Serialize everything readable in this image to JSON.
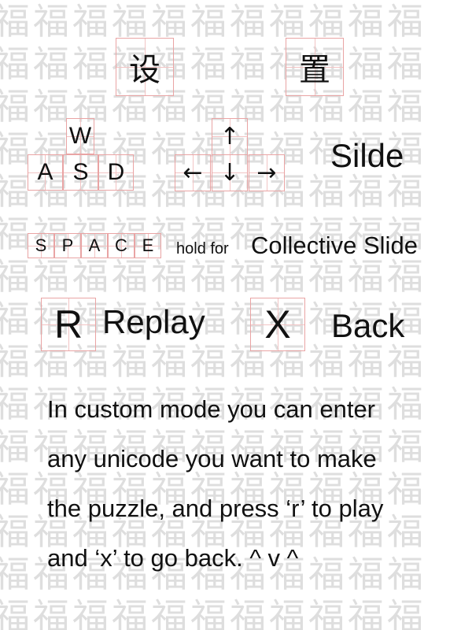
{
  "background": {
    "rows": [
      "福福福福福福福福福福福",
      "福福福福福福福福福福福",
      "福福福福福福福福福福福",
      "福福福福福福福福福福福",
      "福福福福福福福福福福福",
      "福福福福福福福福福福福",
      "福福福福福福福福福福福",
      "福福福福福福福福福福福",
      "福福福福福福福福福福福",
      "福福福福福福福福福福福",
      "福福福福福福福福福福福",
      "福福福福福福福福福福福",
      "福福福福福福福福福福福",
      "福福福福福福福福福福福",
      "福福福福福福福福福福福"
    ]
  },
  "title": {
    "char1": "设",
    "char2": "置"
  },
  "movement": {
    "keys": {
      "up": "W",
      "left": "A",
      "down": "S",
      "right": "D"
    },
    "arrows": {
      "up": "↑",
      "left": "←",
      "down": "↓",
      "right": "→"
    },
    "label": "Silde"
  },
  "space": {
    "letters": [
      "S",
      "P",
      "A",
      "C",
      "E"
    ],
    "hold_label": "hold for",
    "action_label": "Collective Slide"
  },
  "replay": {
    "key": "R",
    "label": "Replay"
  },
  "back": {
    "key": "X",
    "label": "Back"
  },
  "instructions": {
    "lines": [
      "In custom mode you can enter",
      "any unicode you want to make",
      "the puzzle, and press ‘r’ to play",
      "and ‘x’ to go back. ^ v ^"
    ]
  },
  "colors": {
    "grid": "#e9a4a4",
    "background_glyph": "#dedede",
    "text": "#111111"
  }
}
